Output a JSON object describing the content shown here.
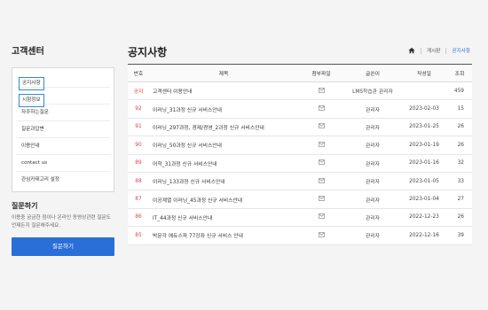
{
  "sidebar": {
    "title": "고객센터",
    "items": [
      {
        "label": "공지사항",
        "highlighted": true
      },
      {
        "label": "시험정보",
        "highlighted": true
      },
      {
        "label": "자주하는질문",
        "highlighted": false
      },
      {
        "label": "질문과답변",
        "highlighted": false
      },
      {
        "label": "이용안내",
        "highlighted": false
      },
      {
        "label": "contact us",
        "highlighted": false
      },
      {
        "label": "관심카테고리 설정",
        "highlighted": false
      }
    ],
    "ask": {
      "title": "질문하기",
      "desc_line1": "이용중 궁금한 점이나 온라인 동영상관련 질문도",
      "desc_line2": "언제든지 질문해주세요.",
      "button_label": "질문하기"
    }
  },
  "main": {
    "title": "공지사항",
    "breadcrumb": {
      "home_icon": "home-icon",
      "level1": "게시판",
      "current": "공지사항"
    },
    "columns": [
      "번호",
      "제목",
      "첨부파일",
      "글쓴이",
      "작성일",
      "조회"
    ],
    "rows": [
      {
        "num": "공지",
        "title": "고객센터 이용안내",
        "attachment": "mail-icon",
        "author": "LMS학습관 관리자",
        "date": "",
        "views": "459"
      },
      {
        "num": "92",
        "title": "이러닝_31과정 신규 서비스안내",
        "attachment": "mail-icon",
        "author": "관리자",
        "date": "2023-02-03",
        "views": "15"
      },
      {
        "num": "91",
        "title": "이러닝_297과정, 경제/경영_2과정 신규 서비스안내",
        "attachment": "mail-icon",
        "author": "관리자",
        "date": "2023-01-25",
        "views": "26"
      },
      {
        "num": "90",
        "title": "이러닝_50과정 신규 서비스안내",
        "attachment": "mail-icon",
        "author": "관리자",
        "date": "2023-01-19",
        "views": "26"
      },
      {
        "num": "89",
        "title": "어학_31과정 신규 서비스안내",
        "attachment": "mail-icon",
        "author": "관리자",
        "date": "2023-01-16",
        "views": "32"
      },
      {
        "num": "88",
        "title": "이러닝_133과정 신규 서비스안내",
        "attachment": "mail-icon",
        "author": "관리자",
        "date": "2023-01-05",
        "views": "33"
      },
      {
        "num": "87",
        "title": "이공계열 이러닝_45과정 신규 서비스안내",
        "attachment": "mail-icon",
        "author": "관리자",
        "date": "2023-01-04",
        "views": "27"
      },
      {
        "num": "86",
        "title": "IT_44과정 신규 서비스안내",
        "attachment": "mail-icon",
        "author": "관리자",
        "date": "2022-12-23",
        "views": "26"
      },
      {
        "num": "85",
        "title": "박문각 에듀스파 77강좌 신규 서비스 안내",
        "attachment": "mail-icon",
        "author": "관리자",
        "date": "2022-12-16",
        "views": "39"
      }
    ]
  },
  "colors": {
    "accent": "#2a6fd8",
    "highlight_border": "#2f8ad6",
    "notice_num": "#e04040"
  }
}
